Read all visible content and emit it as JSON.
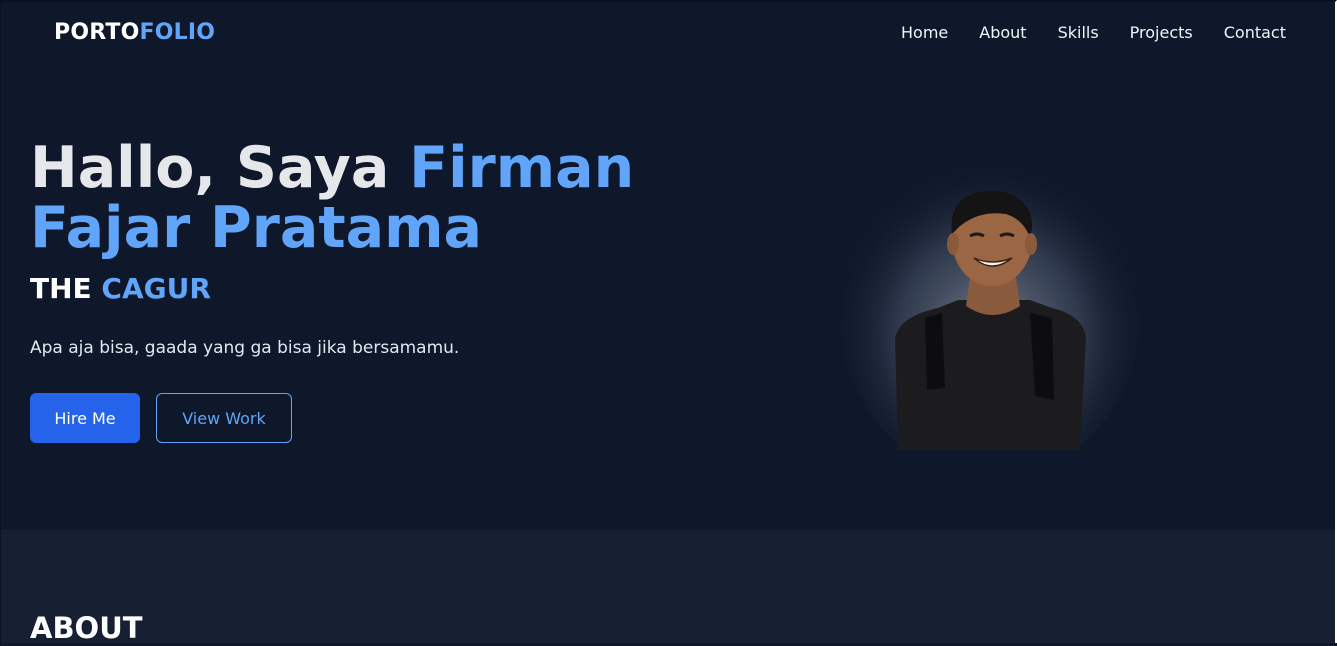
{
  "brand": {
    "logo_part1": "PORTO",
    "logo_part2": "FOLIO"
  },
  "nav": {
    "items": [
      {
        "label": "Home"
      },
      {
        "label": "About"
      },
      {
        "label": "Skills"
      },
      {
        "label": "Projects"
      },
      {
        "label": "Contact"
      }
    ]
  },
  "hero": {
    "title_part1": "Hallo, Saya ",
    "title_part2": "Firman Fajar Pratama",
    "tagline_part1": "THE ",
    "tagline_part2": "CAGUR",
    "description": "Apa aja bisa, gaada yang ga bisa jika bersamamu.",
    "primary_button": "Hire Me",
    "secondary_button": "View Work",
    "photo_icon": "profile-photo"
  },
  "about": {
    "heading": "ABOUT"
  },
  "colors": {
    "background": "#0f172a",
    "accent": "#60a5fa",
    "primary_button": "#2563eb",
    "section_alt": "#162032"
  }
}
